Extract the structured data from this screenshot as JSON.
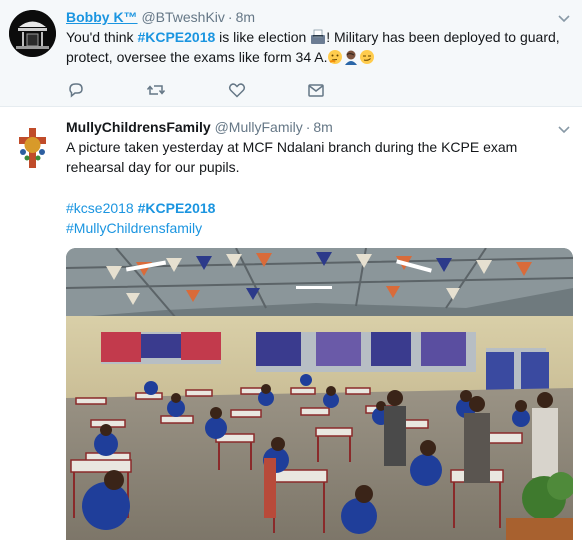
{
  "tweets": [
    {
      "name": "Bobby K™",
      "handle": "@BTweshKiv",
      "dot": "·",
      "time": "8m",
      "text_part1": "You'd think ",
      "hashtag": "#KCPE2018",
      "text_part2": " is like election ",
      "text_part3": "! Military has been deployed to guard, protect, oversee the exams like form 34 A.",
      "actions": [
        "reply-icon",
        "retweet-icon",
        "like-icon",
        "direct-message-icon"
      ]
    },
    {
      "name": "MullyChildrensFamily",
      "handle": "@MullyFamily",
      "dot": "·",
      "time": "8m",
      "text": "A picture taken yesterday at MCF Ndalani branch during the KCPE exam rehearsal day for our pupils.",
      "tag_kcse": "#kcse2018",
      "tag_kcpe": "#KCPE2018",
      "tag_mully": "#MullyChildrensfamily"
    }
  ],
  "colors": {
    "link": "#1b95e0",
    "muted": "#657786",
    "text": "#14171a"
  }
}
